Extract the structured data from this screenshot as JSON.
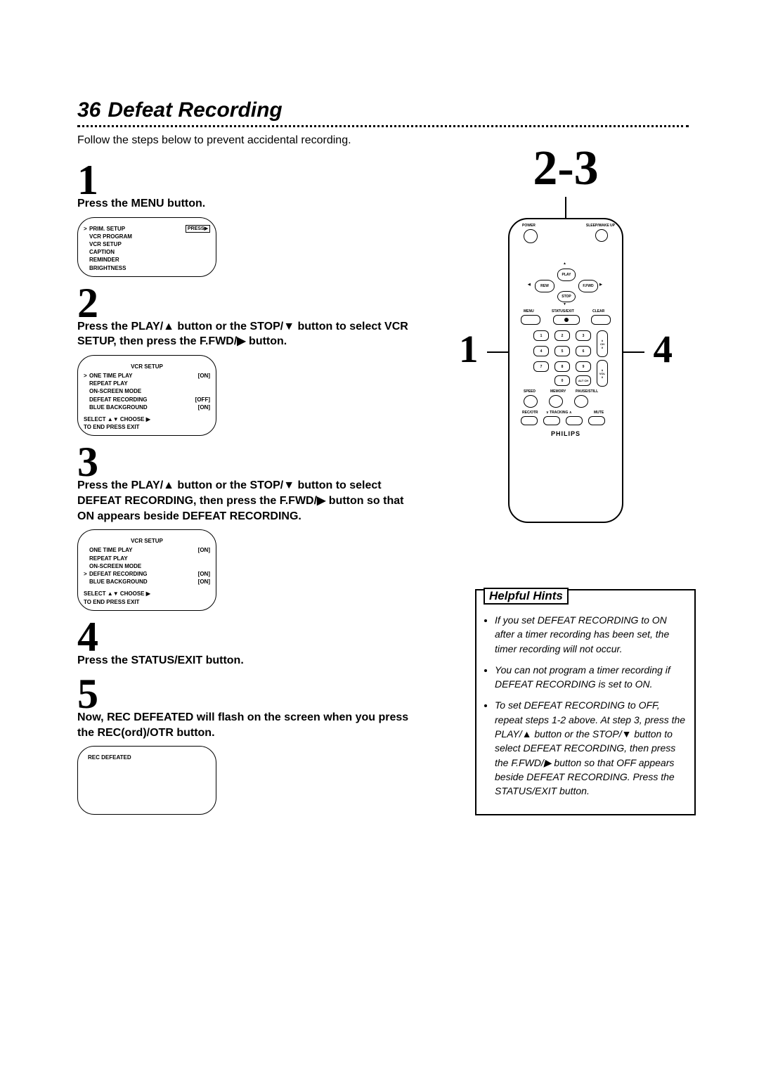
{
  "page_number": "36",
  "title": "Defeat Recording",
  "intro": "Follow the steps below to prevent accidental recording.",
  "steps": {
    "s1": {
      "num": "1",
      "text": "Press the MENU button."
    },
    "s2": {
      "num": "2",
      "text": "Press the PLAY/▲ button or the STOP/▼ button to select VCR SETUP, then press the F.FWD/▶ button."
    },
    "s3": {
      "num": "3",
      "text": "Press the PLAY/▲ button or the STOP/▼ button to select DEFEAT RECORDING, then press the F.FWD/▶ button so that ON appears beside DEFEAT RECORDING."
    },
    "s4": {
      "num": "4",
      "text": "Press the STATUS/EXIT button."
    },
    "s5": {
      "num": "5",
      "text": "Now, REC DEFEATED will flash on the screen when you press the REC(ord)/OTR button."
    }
  },
  "osd1": {
    "press": "PRESS▶",
    "items": [
      "PRIM. SETUP",
      "VCR PROGRAM",
      "VCR SETUP",
      "CAPTION",
      "REMINDER",
      "BRIGHTNESS"
    ],
    "selected": 0
  },
  "osd2": {
    "title": "VCR SETUP",
    "rows": [
      {
        "label": "ONE TIME PLAY",
        "val": "[ON]"
      },
      {
        "label": "REPEAT PLAY",
        "val": ""
      },
      {
        "label": "ON-SCREEN MODE",
        "val": ""
      },
      {
        "label": "DEFEAT RECORDING",
        "val": "[OFF]"
      },
      {
        "label": "BLUE BACKGROUND",
        "val": "[ON]"
      }
    ],
    "selected": 0,
    "foot1": "SELECT ▲▼ CHOOSE ▶",
    "foot2": "TO END PRESS EXIT"
  },
  "osd3": {
    "title": "VCR SETUP",
    "rows": [
      {
        "label": "ONE TIME PLAY",
        "val": "[ON]"
      },
      {
        "label": "REPEAT PLAY",
        "val": ""
      },
      {
        "label": "ON-SCREEN MODE",
        "val": ""
      },
      {
        "label": "DEFEAT RECORDING",
        "val": "[ON]"
      },
      {
        "label": "BLUE BACKGROUND",
        "val": "[ON]"
      }
    ],
    "selected": 3,
    "foot1": "SELECT ▲▼ CHOOSE ▶",
    "foot2": "TO END PRESS EXIT"
  },
  "osd4": {
    "text": "REC DEFEATED"
  },
  "remote": {
    "callout_top": "2-3",
    "callout_left": "1",
    "callout_right": "4",
    "labels": {
      "power": "POWER",
      "sleep": "SLEEP/WAKE UP",
      "play": "PLAY",
      "rew": "REW",
      "ffwd": "F.FWD",
      "stop": "STOP",
      "menu": "MENU",
      "status": "STATUS/EXIT",
      "clear": "CLEAR",
      "speed": "SPEED",
      "memory": "MEMORY",
      "pause": "PAUSE/STILL",
      "rec": "REC/OTR",
      "trk_dn": "∨ TRACKING ∧",
      "mute": "MUTE",
      "ch": "CH",
      "vol": "VOL",
      "altch": "ALT CH",
      "brand": "PHILIPS"
    },
    "numbers": [
      "1",
      "2",
      "3",
      "4",
      "5",
      "6",
      "7",
      "8",
      "9",
      "0"
    ]
  },
  "hints": {
    "title": "Helpful Hints",
    "items": [
      "If you set DEFEAT RECORDING to ON after a timer recording has been set, the timer recording will not occur.",
      "You can not program a timer recording if DEFEAT RECORDING is set to ON.",
      "To set DEFEAT RECORDING to OFF, repeat steps 1-2 above. At step 3, press the PLAY/▲ button or the STOP/▼ button to select DEFEAT RECORDING, then press the F.FWD/▶ button so that OFF appears beside DEFEAT RECORDING. Press the STATUS/EXIT button."
    ]
  }
}
